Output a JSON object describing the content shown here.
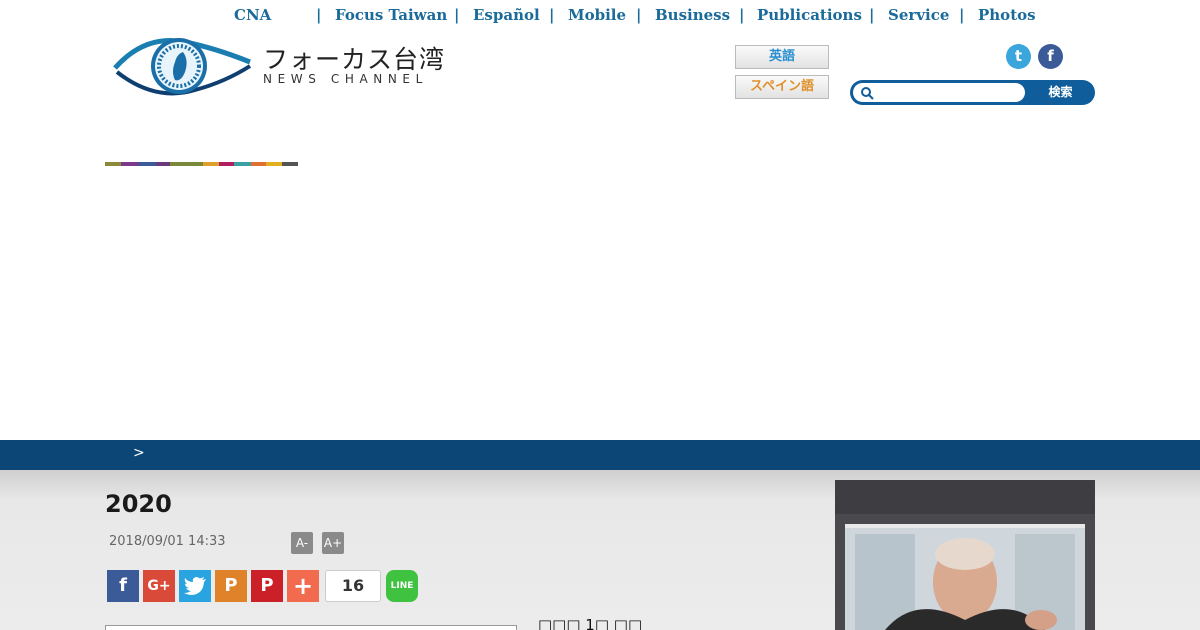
{
  "topnav": {
    "cna": "CNA",
    "separator": "|",
    "items": [
      "Focus Taiwan",
      "Español",
      "Mobile",
      "Business",
      "Publications",
      "Service",
      "Photos"
    ]
  },
  "logo": {
    "title_jp": "フォーカス台湾",
    "subtitle": "NEWS CHANNEL"
  },
  "lang": {
    "english": "英語",
    "spanish": "スペイン語"
  },
  "social": {
    "twitter": "t",
    "facebook": "f"
  },
  "search": {
    "button": "検索",
    "value": "",
    "placeholder": ""
  },
  "colors": {
    "nav_text": "#1a6a9a",
    "breadcrumb_bar": "#0c4677",
    "search_bar": "#0f5d9a",
    "strip": [
      "#8a8a3a",
      "#7a3a8a",
      "#3a5a9a",
      "#6a3a7a",
      "#7a8a3a",
      "#e0a030",
      "#b02060",
      "#3aa0a0",
      "#e07030",
      "#e0b020",
      "#555555"
    ]
  },
  "breadcrumb": {
    "separator": ">"
  },
  "article": {
    "title": "2020",
    "date": "2018/09/01 14:33",
    "font_minus": "A-",
    "font_plus": "A+",
    "share_count": "16",
    "share_icons": [
      "facebook-share-icon",
      "google-plus-share-icon",
      "twitter-share-icon",
      "plurk-share-icon",
      "pinterest-share-icon",
      "add-share-icon",
      "line-share-icon"
    ],
    "line_label": "LINE",
    "gplus_label": "G+",
    "plus_label": "+",
    "pin_label": "P",
    "plurk_label": "P",
    "side_text": "□□□ 1□ □□"
  }
}
